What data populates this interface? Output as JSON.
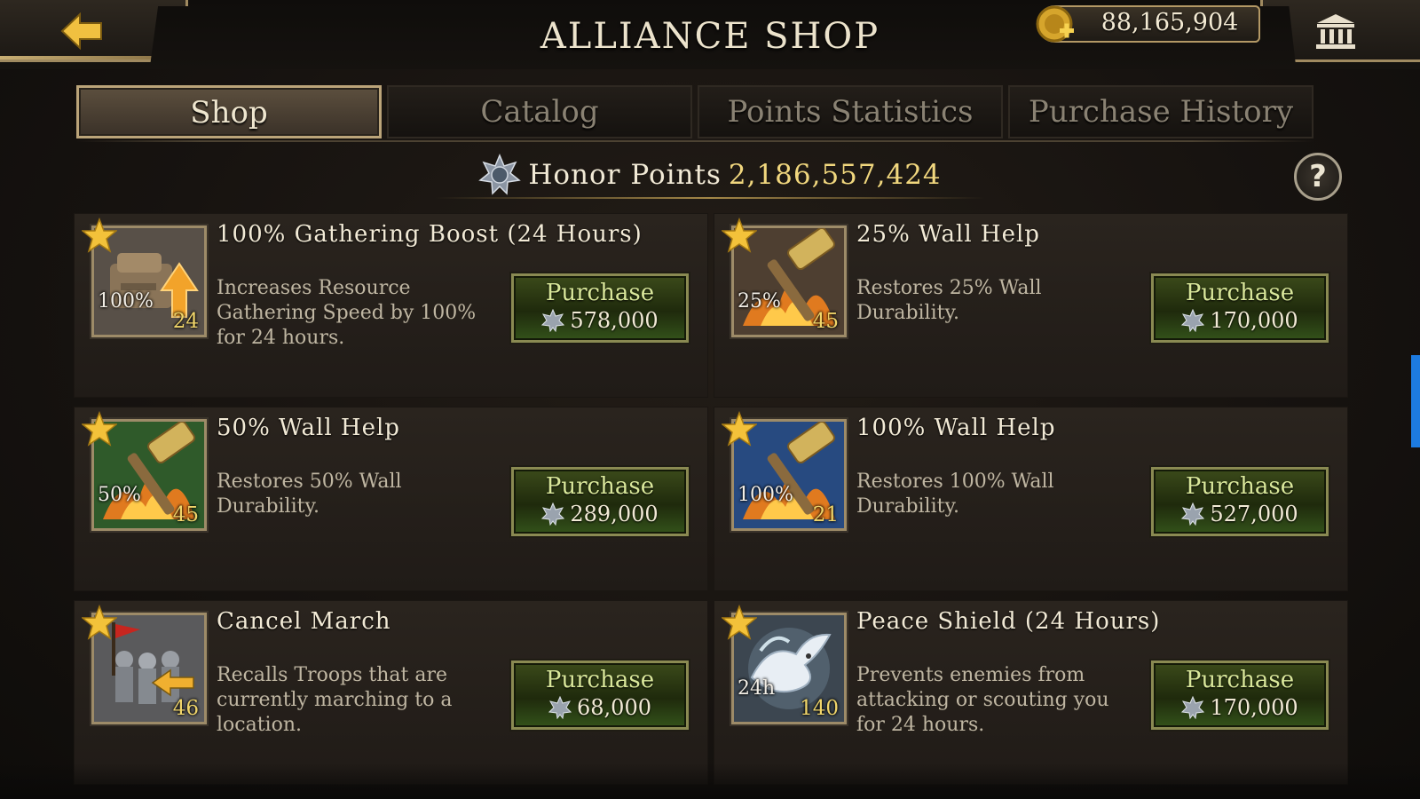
{
  "header": {
    "title": "ALLIANCE SHOP",
    "gold": "88,165,904"
  },
  "tabs": [
    {
      "label": "Shop",
      "active": true
    },
    {
      "label": "Catalog",
      "active": false
    },
    {
      "label": "Points Statistics",
      "active": false
    },
    {
      "label": "Purchase History",
      "active": false
    }
  ],
  "honor": {
    "label": "Honor Points",
    "value": "2,186,557,424"
  },
  "help": "?",
  "purchase_label": "Purchase",
  "items": [
    {
      "name": "100% Gathering Boost (24 Hours)",
      "desc": "Increases Resource Gathering Speed by 100% for 24 hours.",
      "badge": "100%",
      "qty": "24",
      "price": "578,000",
      "art": "gather"
    },
    {
      "name": "25% Wall Help",
      "desc": "Restores 25% Wall Durability.",
      "badge": "25%",
      "qty": "45",
      "price": "170,000",
      "art": "wall-brown"
    },
    {
      "name": "50% Wall Help",
      "desc": "Restores 50% Wall Durability.",
      "badge": "50%",
      "qty": "45",
      "price": "289,000",
      "art": "wall-green"
    },
    {
      "name": "100% Wall Help",
      "desc": "Restores 100% Wall Durability.",
      "badge": "100%",
      "qty": "21",
      "price": "527,000",
      "art": "wall-blue"
    },
    {
      "name": "Cancel March",
      "desc": "Recalls Troops that are currently marching to a location.",
      "badge": "",
      "qty": "46",
      "price": "68,000",
      "art": "march"
    },
    {
      "name": "Peace Shield (24 Hours)",
      "desc": "Prevents enemies from attacking or scouting you for 24 hours.",
      "badge": "24h",
      "qty": "140",
      "price": "170,000",
      "art": "shield"
    }
  ],
  "colors": {
    "accent_gold": "#f1d77e",
    "button_green": "#33521a",
    "frame": "#9d8b68"
  }
}
